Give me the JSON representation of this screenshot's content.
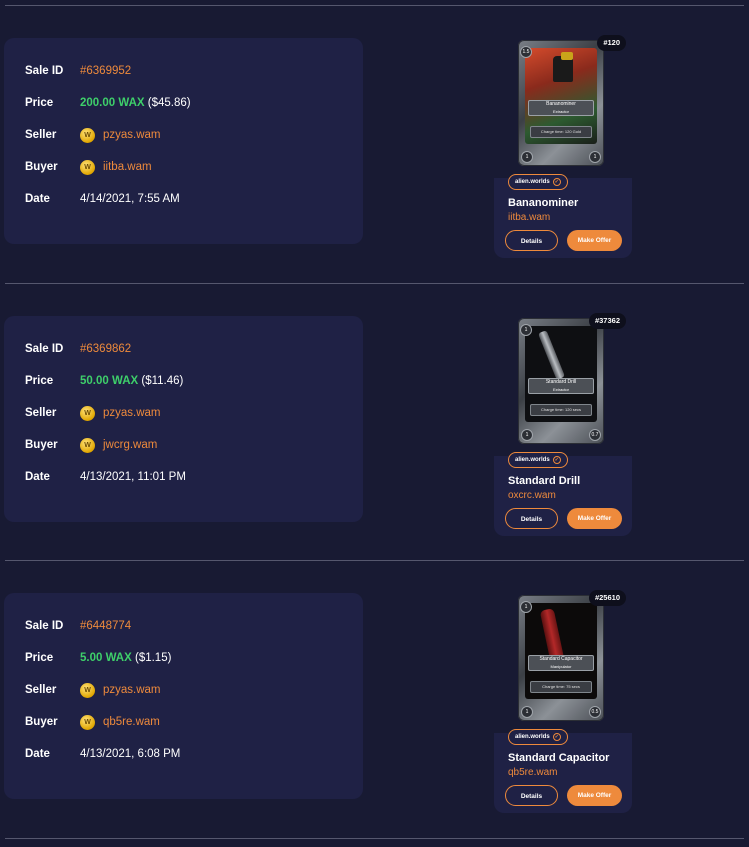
{
  "labels": {
    "sale_id": "Sale ID",
    "price": "Price",
    "seller": "Seller",
    "buyer": "Buyer",
    "date": "Date"
  },
  "sales": [
    {
      "sale_id": "#6369952",
      "price_wax": "200.00 WAX",
      "price_usd": "($45.86)",
      "seller": "pzyas.wam",
      "buyer": "iitba.wam",
      "date": "4/14/2021, 7:55 AM",
      "card": {
        "mint": "#120",
        "collection": "alien.worlds",
        "name": "Bananominer",
        "owner": "iitba.wam",
        "details_label": "Details",
        "offer_label": "Make Offer",
        "art_title": "Bananominer",
        "art_subtitle": "Extractor",
        "art_stat": "Charge time: 120 Gold",
        "corner_tl": "1.5",
        "corner_bl": "1",
        "corner_br": "1",
        "image_colors": [
          "#c0402a",
          "#2a6a34"
        ]
      }
    },
    {
      "sale_id": "#6369862",
      "price_wax": "50.00 WAX",
      "price_usd": "($11.46)",
      "seller": "pzyas.wam",
      "buyer": "jwcrg.wam",
      "date": "4/13/2021, 11:01 PM",
      "card": {
        "mint": "#37362",
        "collection": "alien.worlds",
        "name": "Standard Drill",
        "owner": "oxcrc.wam",
        "details_label": "Details",
        "offer_label": "Make Offer",
        "art_title": "Standard Drill",
        "art_subtitle": "Extractor",
        "art_stat": "Charge time: 120 secs",
        "corner_tl": "1",
        "corner_bl": "1",
        "corner_br": "0.7",
        "image_colors": [
          "#111214",
          "#7a7d82"
        ]
      }
    },
    {
      "sale_id": "#6448774",
      "price_wax": "5.00 WAX",
      "price_usd": "($1.15)",
      "seller": "pzyas.wam",
      "buyer": "qb5re.wam",
      "date": "4/13/2021, 6:08 PM",
      "card": {
        "mint": "#25610",
        "collection": "alien.worlds",
        "name": "Standard Capacitor",
        "owner": "qb5re.wam",
        "details_label": "Details",
        "offer_label": "Make Offer",
        "art_title": "Standard Capacitor",
        "art_subtitle": "Manipulator",
        "art_stat": "Charge time: 75 secs",
        "corner_tl": "1",
        "corner_bl": "1",
        "corner_br": "0.5",
        "image_colors": [
          "#0d0a0a",
          "#8c1e1e"
        ]
      }
    }
  ]
}
